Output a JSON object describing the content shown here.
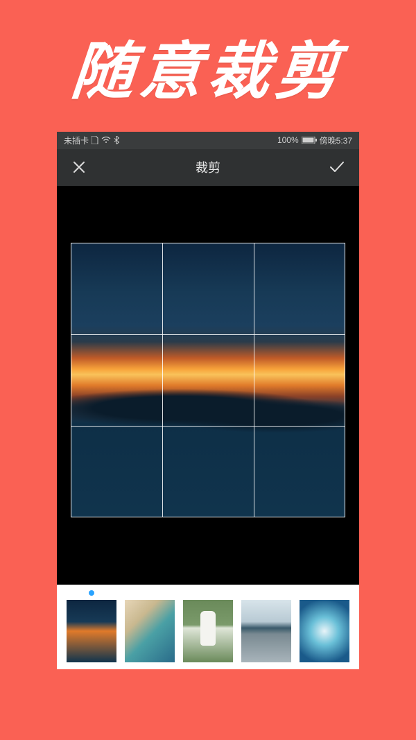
{
  "headline": "随意裁剪",
  "statusbar": {
    "sim_text": "未插卡",
    "battery_text": "100%",
    "time_text": "傍晚5:37"
  },
  "navbar": {
    "title": "裁剪"
  },
  "thumbnails": {
    "selected_index": 0
  }
}
